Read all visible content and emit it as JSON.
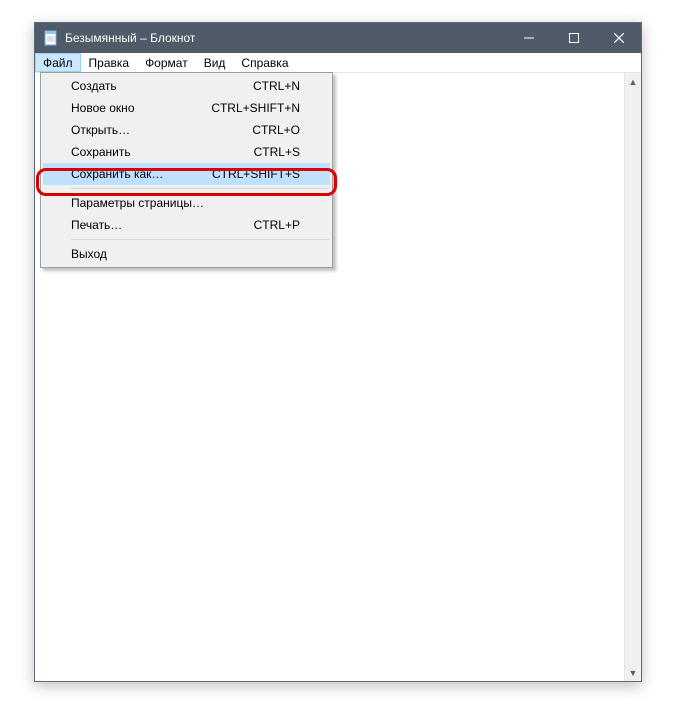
{
  "window": {
    "title": "Безымянный – Блокнот"
  },
  "menubar": {
    "items": [
      {
        "label": "Файл",
        "active": true
      },
      {
        "label": "Правка",
        "active": false
      },
      {
        "label": "Формат",
        "active": false
      },
      {
        "label": "Вид",
        "active": false
      },
      {
        "label": "Справка",
        "active": false
      }
    ]
  },
  "dropdown": {
    "items": [
      {
        "label": "Создать",
        "shortcut": "CTRL+N"
      },
      {
        "label": "Новое окно",
        "shortcut": "CTRL+SHIFT+N"
      },
      {
        "label": "Открыть…",
        "shortcut": "CTRL+O"
      },
      {
        "label": "Сохранить",
        "shortcut": "CTRL+S"
      },
      {
        "label": "Сохранить как…",
        "shortcut": "CTRL+SHIFT+S",
        "selected": true
      },
      {
        "separator": true
      },
      {
        "label": "Параметры страницы…",
        "shortcut": ""
      },
      {
        "label": "Печать…",
        "shortcut": "CTRL+P"
      },
      {
        "separator": true
      },
      {
        "label": "Выход",
        "shortcut": ""
      }
    ]
  },
  "scroll": {
    "up": "▲",
    "down": "▼"
  }
}
